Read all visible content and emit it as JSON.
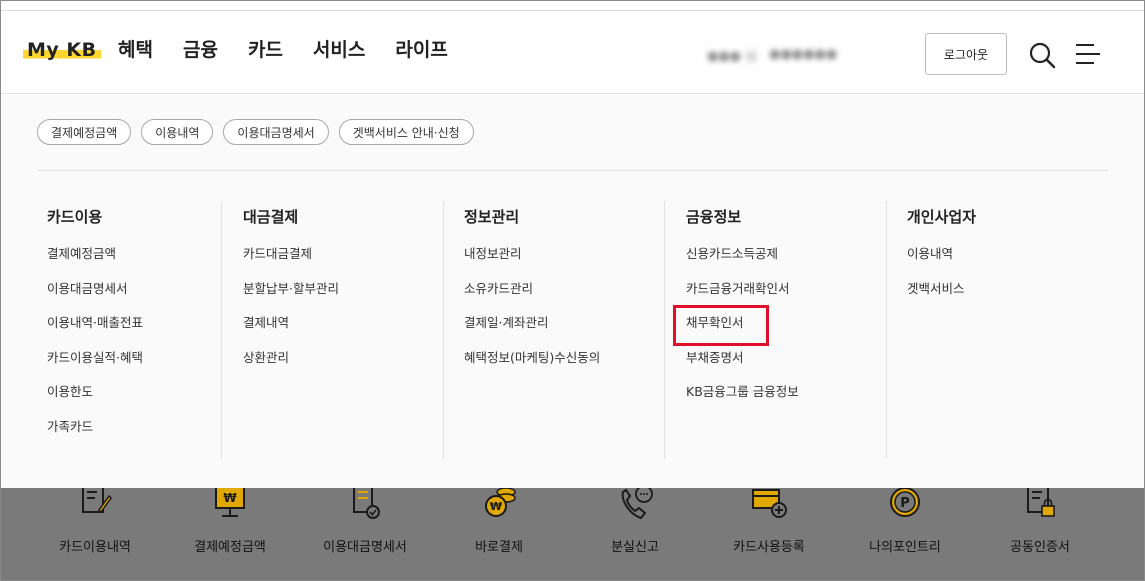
{
  "header": {
    "logo": "My KB",
    "nav": [
      "혜택",
      "금융",
      "카드",
      "서비스",
      "라이프"
    ],
    "user_info_blurred": [
      "●●● 님",
      "●●●●●●",
      "●●●●●●"
    ],
    "logout_label": "로그아웃",
    "search_icon": "search-icon",
    "menu_icon": "hamburger-menu-icon"
  },
  "chips": [
    "결제예정금액",
    "이용내역",
    "이용대금명세서",
    "겟백서비스 안내·신청"
  ],
  "columns": [
    {
      "title": "카드이용",
      "items": [
        "결제예정금액",
        "이용대금명세서",
        "이용내역·매출전표",
        "카드이용실적·혜택",
        "이용한도",
        "가족카드"
      ]
    },
    {
      "title": "대금결제",
      "items": [
        "카드대금결제",
        "분할납부·할부관리",
        "결제내역",
        "상환관리"
      ]
    },
    {
      "title": "정보관리",
      "items": [
        "내정보관리",
        "소유카드관리",
        "결제일·계좌관리",
        "혜택정보(마케팅)수신동의"
      ]
    },
    {
      "title": "금융정보",
      "items": [
        "신용카드소득공제",
        "카드금융거래확인서",
        "채무확인서",
        "부채증명서",
        "KB금융그룹 금융정보"
      ]
    },
    {
      "title": "개인사업자",
      "items": [
        "이용내역",
        "겟백서비스"
      ]
    }
  ],
  "highlighted_item": "채무확인서",
  "quick_menu": [
    {
      "label": "카드이용내역",
      "icon": "document-pen-icon"
    },
    {
      "label": "결제예정금액",
      "icon": "monitor-won-icon"
    },
    {
      "label": "이용대금명세서",
      "icon": "statement-check-icon"
    },
    {
      "label": "바로결제",
      "icon": "coin-won-icon"
    },
    {
      "label": "분실신고",
      "icon": "phone-call-icon"
    },
    {
      "label": "카드사용등록",
      "icon": "card-add-icon"
    },
    {
      "label": "나의포인트리",
      "icon": "point-p-icon"
    },
    {
      "label": "공동인증서",
      "icon": "certificate-lock-icon"
    }
  ],
  "colors": {
    "accent_yellow": "#ffd630",
    "highlight_red": "#e0102b",
    "dim_overlay": "#7a7a7a"
  }
}
